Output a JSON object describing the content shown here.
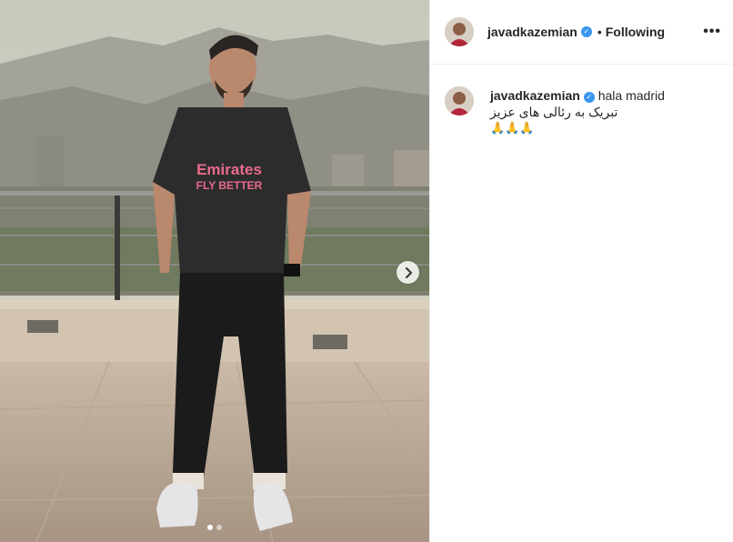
{
  "post": {
    "image_alt": "",
    "carousel": {
      "slide_count": 2,
      "active_index": 0
    }
  },
  "header": {
    "username": "javadkazemian",
    "follow_state": "Following",
    "separator": "•",
    "more": "•••"
  },
  "comment": {
    "username": "javadkazemian",
    "text_line1": "hala madrid",
    "text_line2": "تبریک به رئالی های عزیز",
    "text_line3": "🙏🙏🙏"
  },
  "colors": {
    "verified_blue": "#3897f0",
    "text": "#262626",
    "divider": "#efefef"
  },
  "icons": {
    "next": "chevron-right-icon",
    "verified": "verified-badge-icon",
    "more": "more-options-icon"
  }
}
